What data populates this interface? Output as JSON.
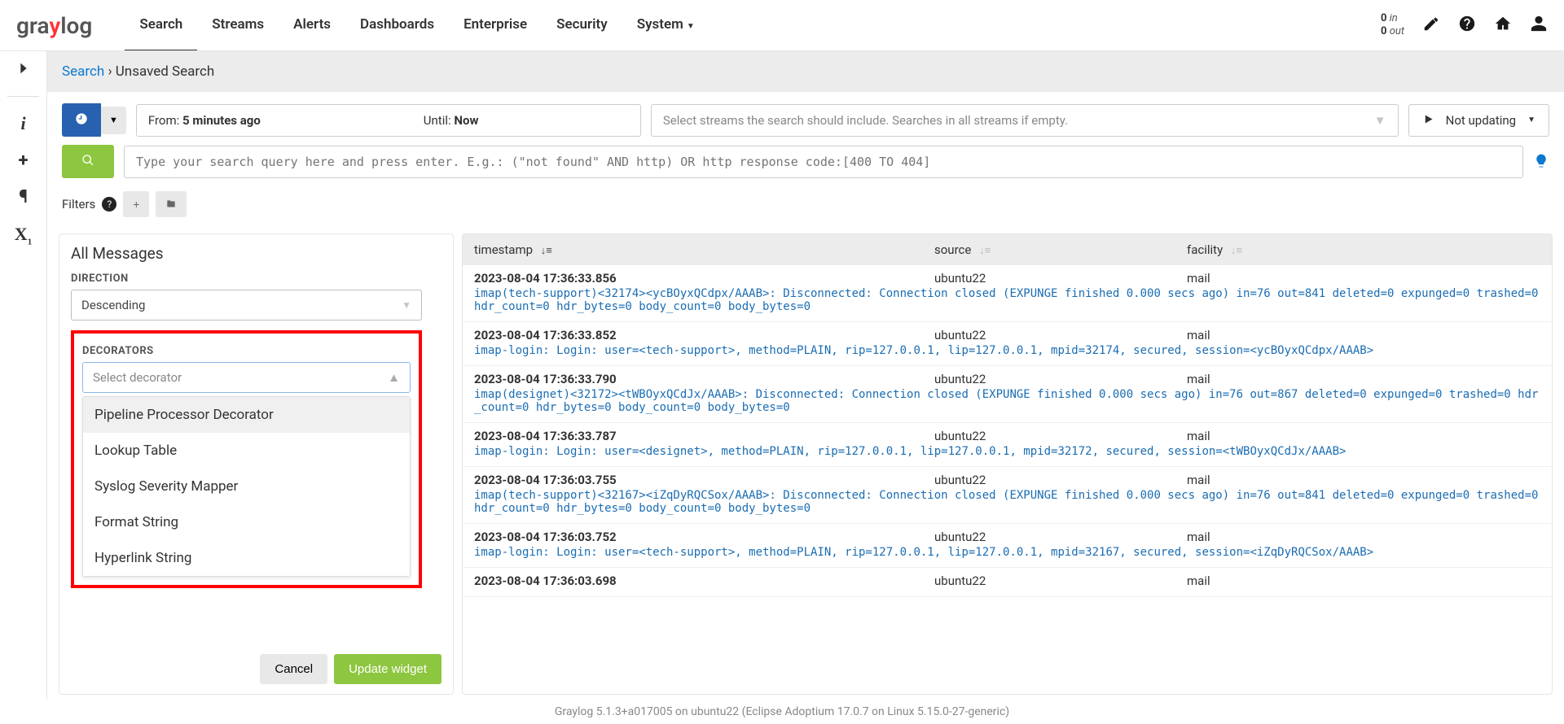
{
  "logo": {
    "left": "gra",
    "mid": "y",
    "right": "log"
  },
  "nav": {
    "items": [
      {
        "label": "Search",
        "active": true
      },
      {
        "label": "Streams"
      },
      {
        "label": "Alerts"
      },
      {
        "label": "Dashboards"
      },
      {
        "label": "Enterprise"
      },
      {
        "label": "Security"
      },
      {
        "label": "System",
        "caret": true
      }
    ]
  },
  "throughput": {
    "in_count": "0",
    "in_label": "in",
    "out_count": "0",
    "out_label": "out"
  },
  "breadcrumb": {
    "link": "Search",
    "sep": "›",
    "current": "Unsaved Search"
  },
  "timerange": {
    "from_label": "From:",
    "from_value": "5 minutes ago",
    "until_label": "Until:",
    "until_value": "Now"
  },
  "streams_placeholder": "Select streams the search should include. Searches in all streams if empty.",
  "updating": {
    "label": "Not updating"
  },
  "search_placeholder": "Type your search query here and press enter. E.g.: (\"not found\" AND http) OR http response code:[400 TO 404]",
  "filters": {
    "label": "Filters"
  },
  "all_messages_title": "All Messages",
  "direction": {
    "label": "DIRECTION",
    "value": "Descending"
  },
  "decorators": {
    "label": "DECORATORS",
    "placeholder": "Select decorator",
    "options": [
      "Pipeline Processor Decorator",
      "Lookup Table",
      "Syslog Severity Mapper",
      "Format String",
      "Hyperlink String"
    ]
  },
  "actions": {
    "cancel": "Cancel",
    "update": "Update widget"
  },
  "columns": {
    "timestamp": "timestamp",
    "source": "source",
    "facility": "facility"
  },
  "rows": [
    {
      "ts": "2023-08-04 17:36:33.856",
      "src": "ubuntu22",
      "fac": "mail",
      "body": "imap(tech-support)<32174><ycBOyxQCdpx/AAAB>: Disconnected: Connection closed (EXPUNGE finished 0.000 secs ago) in=76 out=841 deleted=0 expunged=0 trashed=0 hdr_count=0 hdr_bytes=0 body_count=0 body_bytes=0"
    },
    {
      "ts": "2023-08-04 17:36:33.852",
      "src": "ubuntu22",
      "fac": "mail",
      "body": "imap-login: Login: user=<tech-support>, method=PLAIN, rip=127.0.0.1, lip=127.0.0.1, mpid=32174, secured, session=<ycBOyxQCdpx/AAAB>"
    },
    {
      "ts": "2023-08-04 17:36:33.790",
      "src": "ubuntu22",
      "fac": "mail",
      "body": "imap(designet)<32172><tWBOyxQCdJx/AAAB>: Disconnected: Connection closed (EXPUNGE finished 0.000 secs ago) in=76 out=867 deleted=0 expunged=0 trashed=0 hdr_count=0 hdr_bytes=0 body_count=0 body_bytes=0"
    },
    {
      "ts": "2023-08-04 17:36:33.787",
      "src": "ubuntu22",
      "fac": "mail",
      "body": "imap-login: Login: user=<designet>, method=PLAIN, rip=127.0.0.1, lip=127.0.0.1, mpid=32172, secured, session=<tWBOyxQCdJx/AAAB>"
    },
    {
      "ts": "2023-08-04 17:36:03.755",
      "src": "ubuntu22",
      "fac": "mail",
      "body": "imap(tech-support)<32167><iZqDyRQCSox/AAAB>: Disconnected: Connection closed (EXPUNGE finished 0.000 secs ago) in=76 out=841 deleted=0 expunged=0 trashed=0 hdr_count=0 hdr_bytes=0 body_count=0 body_bytes=0"
    },
    {
      "ts": "2023-08-04 17:36:03.752",
      "src": "ubuntu22",
      "fac": "mail",
      "body": "imap-login: Login: user=<tech-support>, method=PLAIN, rip=127.0.0.1, lip=127.0.0.1, mpid=32167, secured, session=<iZqDyRQCSox/AAAB>"
    },
    {
      "ts": "2023-08-04 17:36:03.698",
      "src": "ubuntu22",
      "fac": "mail",
      "body": ""
    }
  ],
  "footer": "Graylog 5.1.3+a017005 on ubuntu22 (Eclipse Adoptium 17.0.7 on Linux 5.15.0-27-generic)"
}
